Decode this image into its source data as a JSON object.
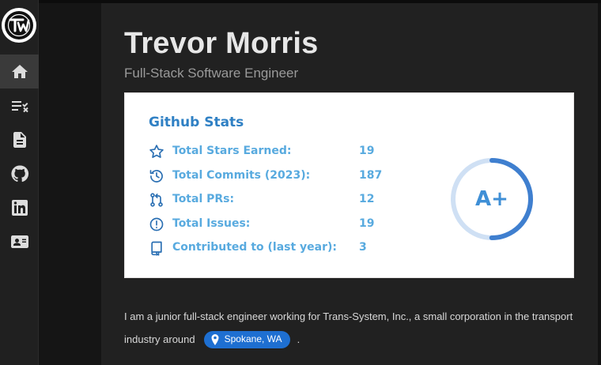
{
  "sidebar": {
    "logo_text": "TM",
    "items": [
      {
        "icon": "home-icon"
      },
      {
        "icon": "checklist-icon"
      },
      {
        "icon": "document-icon"
      },
      {
        "icon": "github-icon"
      },
      {
        "icon": "linkedin-icon"
      },
      {
        "icon": "contact-card-icon"
      }
    ]
  },
  "header": {
    "name": "Trevor Morris",
    "subtitle": "Full-Stack Software Engineer"
  },
  "github_stats": {
    "title": "Github Stats",
    "rank": "A+",
    "rank_progress": 0.5,
    "stats": [
      {
        "icon": "star-icon",
        "label": "Total Stars Earned:",
        "value": "19"
      },
      {
        "icon": "clock-icon",
        "label": "Total Commits (2023):",
        "value": "187"
      },
      {
        "icon": "pull-request-icon",
        "label": "Total PRs:",
        "value": "12"
      },
      {
        "icon": "issue-icon",
        "label": "Total Issues:",
        "value": "19"
      },
      {
        "icon": "repo-icon",
        "label": "Contributed to (last year):",
        "value": "3"
      }
    ]
  },
  "bio": {
    "line1": "I am a junior full-stack engineer working for Trans-System, Inc., a small corporation in the transport",
    "line2_start": "industry around",
    "location": "Spokane, WA",
    "line2_end": "."
  },
  "colors": {
    "accent": "#2f80c4",
    "stat_text": "#58aadf",
    "rank_ring": "#3f7fcf",
    "rank_track": "#cfe0f4",
    "chip": "#1e6fd1"
  }
}
